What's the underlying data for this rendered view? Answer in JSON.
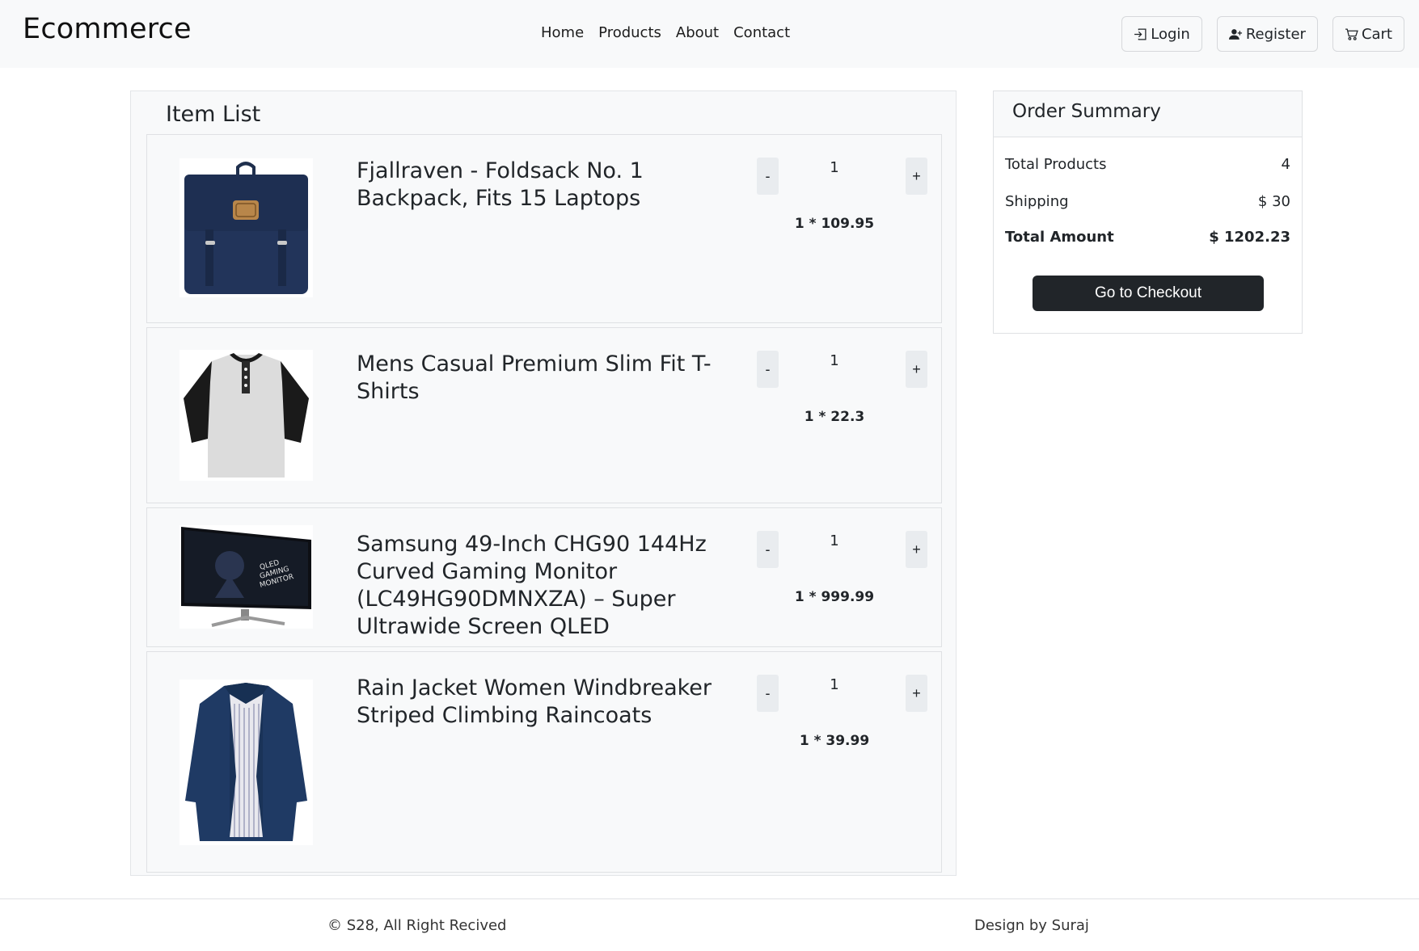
{
  "navbar": {
    "brand": "Ecommerce",
    "links": [
      "Home",
      "Products",
      "About",
      "Contact"
    ],
    "login_label": "Login",
    "register_label": "Register",
    "cart_label": "Cart"
  },
  "item_list": {
    "title": "Item List",
    "items": [
      {
        "name": "Fjallraven - Foldsack No. 1 Backpack, Fits 15 Laptops",
        "qty": "1",
        "subtotal": "1 * 109.95",
        "minus": "-",
        "plus": "+",
        "image": "backpack-image"
      },
      {
        "name": "Mens Casual Premium Slim Fit T-Shirts",
        "qty": "1",
        "subtotal": "1 * 22.3",
        "minus": "-",
        "plus": "+",
        "image": "tshirt-image"
      },
      {
        "name": "Samsung 49-Inch CHG90 144Hz Curved Gaming Monitor (LC49HG90DMNXZA) – Super Ultrawide Screen QLED",
        "qty": "1",
        "subtotal": "1 * 999.99",
        "minus": "-",
        "plus": "+",
        "image": "monitor-image"
      },
      {
        "name": "Rain Jacket Women Windbreaker Striped Climbing Raincoats",
        "qty": "1",
        "subtotal": "1 * 39.99",
        "minus": "-",
        "plus": "+",
        "image": "jacket-image"
      }
    ]
  },
  "summary": {
    "title": "Order Summary",
    "total_products_label": "Total Products",
    "total_products_value": "4",
    "shipping_label": "Shipping",
    "shipping_value": "$ 30",
    "total_amount_label": "Total Amount",
    "total_amount_value": "$ 1202.23",
    "checkout_label": "Go to Checkout"
  },
  "footer": {
    "left": "© S28, All Right Recived",
    "right": "Design by Suraj"
  },
  "colors": {
    "navbar_bg": "#f8f9fa",
    "checkout_bg": "#212529",
    "product_navy": "#1f2f4d"
  }
}
